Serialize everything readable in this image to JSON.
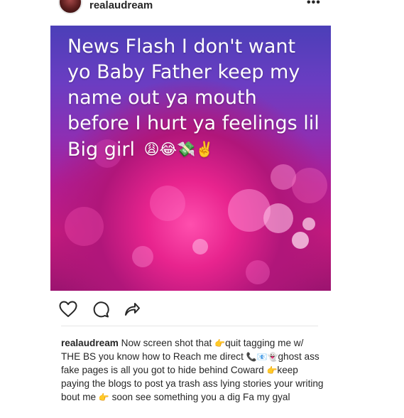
{
  "header": {
    "username": "realaudream",
    "more_icon": "more-options-icon",
    "more_glyph": "•••"
  },
  "post": {
    "image_text": "News Flash I don't want yo Baby Father keep my name out ya mouth before I hurt ya feelings lil Big girl",
    "image_emojis": "😩😂💸✌️",
    "colors": {
      "top": "#4b3fb8",
      "mid": "#8d2fb3",
      "bottom": "#c41b7e",
      "bokeh": "#ff5cb8"
    }
  },
  "actions": {
    "like_icon": "heart-icon",
    "comment_icon": "comment-icon",
    "share_icon": "share-icon"
  },
  "caption": {
    "username": "realaudream",
    "part1": " Now screen shot that ",
    "emoji1": "👉",
    "part2": "quit tagging me w/ THE BS you know how to Reach me direct ",
    "emoji2": "📞📧👻",
    "part3": "ghost ass fake pages is all you got to hide behind Coward ",
    "emoji3": "👉",
    "part4": "keep paying the blogs to post ya trash ass lying stories your writing bout me ",
    "emoji4": "👉",
    "part5": " soon see something you a dig Fa my gyal"
  }
}
